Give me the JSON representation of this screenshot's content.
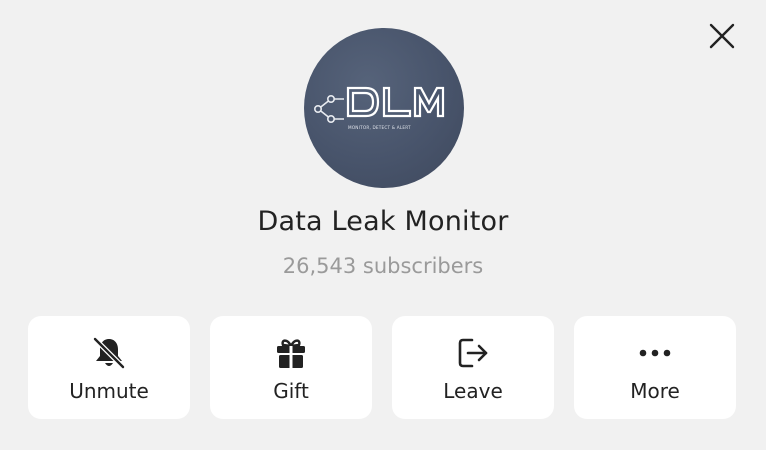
{
  "channel": {
    "name": "Data Leak Monitor",
    "subscribers": "26,543 subscribers",
    "avatar": {
      "logo_text": "DLM",
      "tagline": "MONITOR, DETECT & ALERT"
    }
  },
  "actions": [
    {
      "label": "Unmute",
      "icon": "bell-slash-icon"
    },
    {
      "label": "Gift",
      "icon": "gift-icon"
    },
    {
      "label": "Leave",
      "icon": "leave-icon"
    },
    {
      "label": "More",
      "icon": "more-dots-icon"
    }
  ],
  "colors": {
    "background": "#f1f1f1",
    "card": "#ffffff",
    "avatar": "#4a556c",
    "text": "#222222",
    "muted": "#9a9a9a"
  }
}
